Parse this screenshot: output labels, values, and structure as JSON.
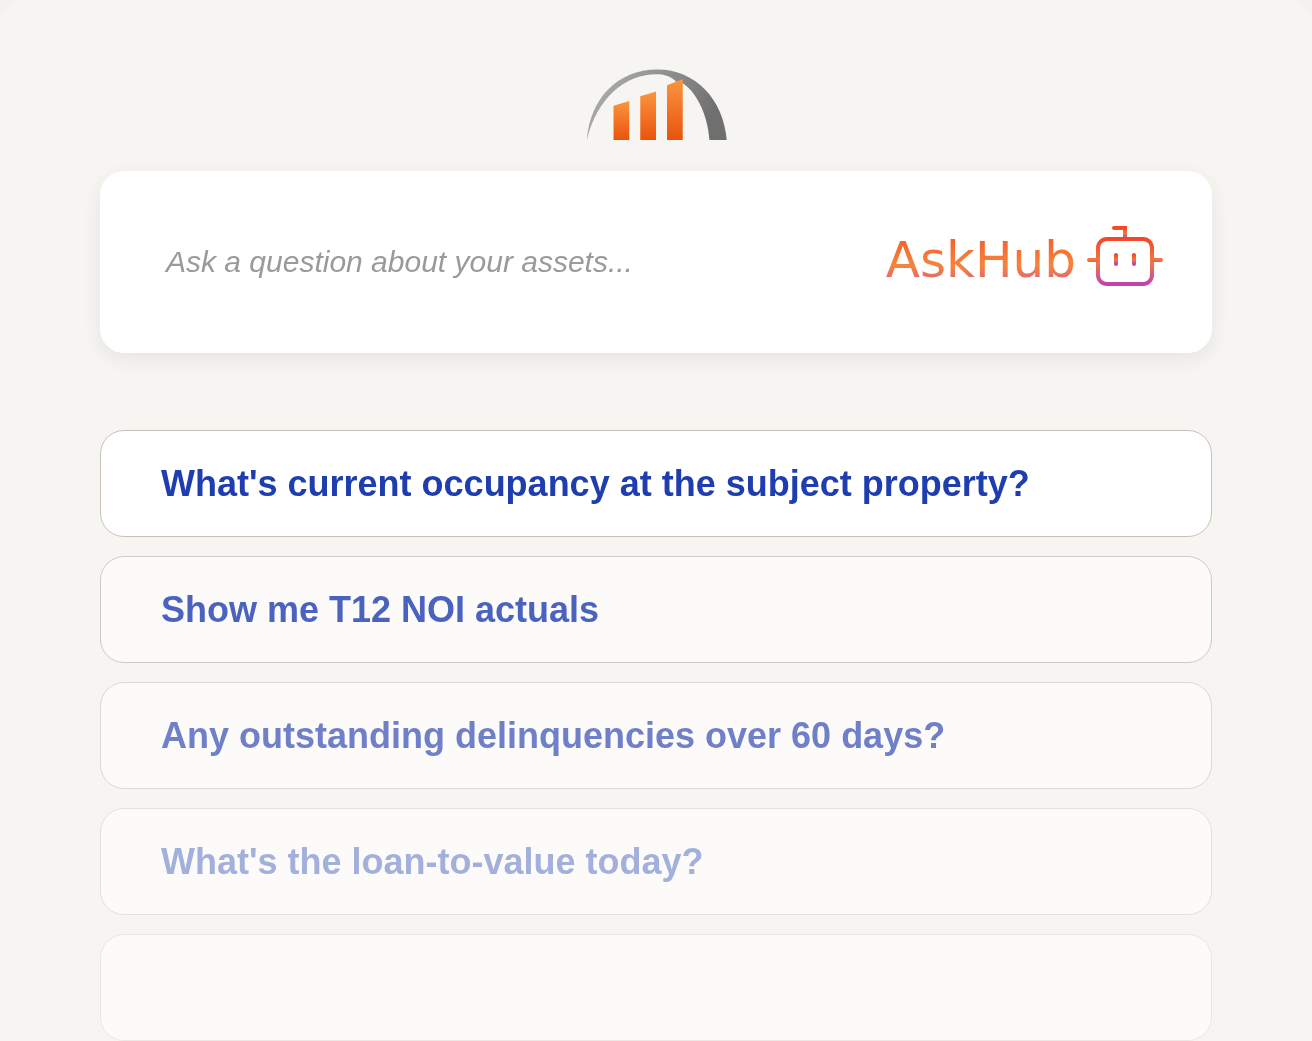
{
  "search": {
    "placeholder": "Ask a question about your assets...",
    "brand": "AskHub"
  },
  "suggestions": [
    {
      "text": "What's current occupancy at the subject property?",
      "selected": true
    },
    {
      "text": "Show me T12 NOI actuals",
      "selected": false
    },
    {
      "text": "Any outstanding delinquencies over 60 days?",
      "selected": false
    },
    {
      "text": "What's the loan-to-value today?",
      "selected": false
    },
    {
      "selected": false
    }
  ]
}
